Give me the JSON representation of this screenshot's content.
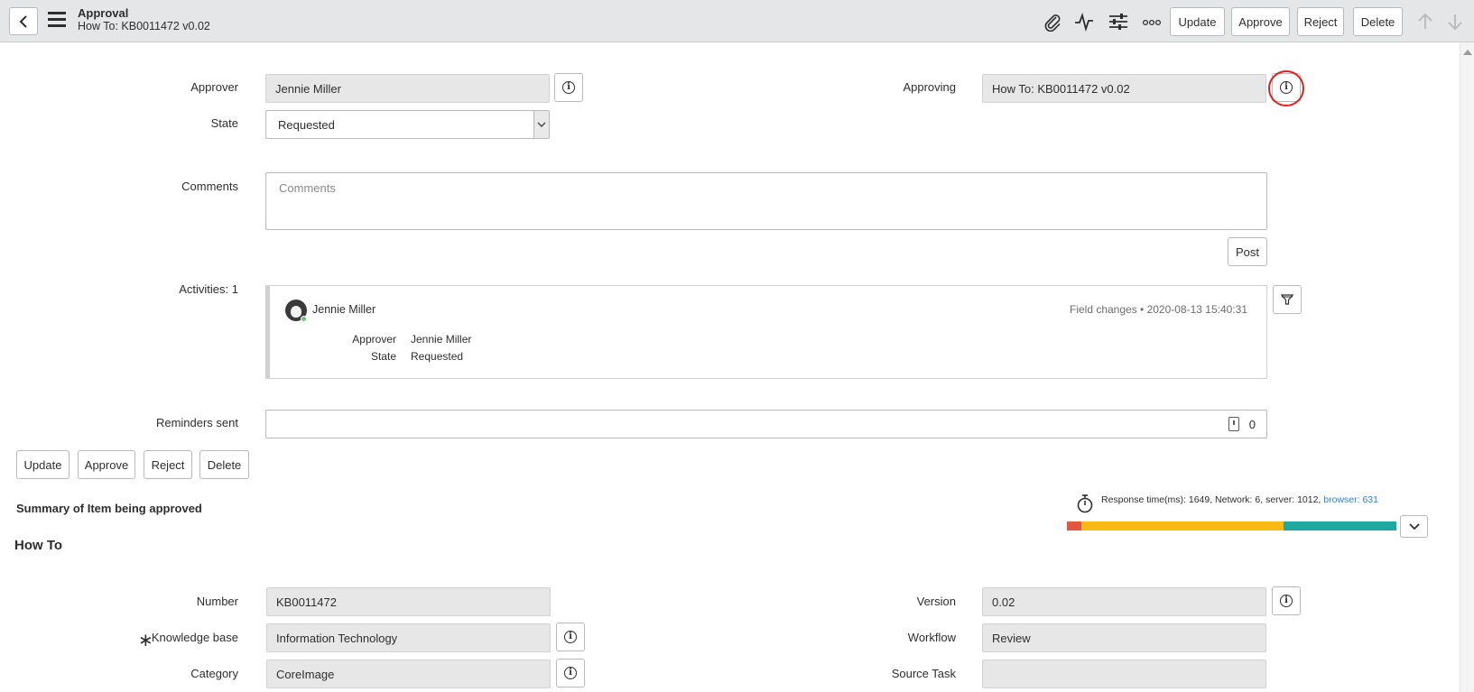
{
  "header": {
    "title": "Approval",
    "subtitle": "How To: KB0011472 v0.02",
    "buttons": {
      "update": "Update",
      "approve": "Approve",
      "reject": "Reject",
      "delete": "Delete"
    }
  },
  "form": {
    "approver": {
      "label": "Approver",
      "value": "Jennie Miller"
    },
    "state": {
      "label": "State",
      "value": "Requested"
    },
    "approving": {
      "label": "Approving",
      "value": "How To: KB0011472 v0.02"
    },
    "comments": {
      "label": "Comments",
      "placeholder": "Comments"
    },
    "post_button": "Post",
    "activities": {
      "label": "Activities: 1",
      "entry": {
        "user": "Jennie Miller",
        "meta": "Field changes  •  2020-08-13 15:40:31",
        "changes": [
          {
            "field": "Approver",
            "value": "Jennie Miller"
          },
          {
            "field": "State",
            "value": "Requested"
          }
        ]
      }
    },
    "reminders": {
      "label": "Reminders sent",
      "value": "0"
    },
    "buttons": {
      "update": "Update",
      "approve": "Approve",
      "reject": "Reject",
      "delete": "Delete"
    }
  },
  "summary": {
    "subtitle": "Summary of Item being approved",
    "heading": "How To",
    "fields": {
      "number": {
        "label": "Number",
        "value": "KB0011472"
      },
      "knowledge_base": {
        "label": "Knowledge base",
        "value": "Information Technology"
      },
      "category": {
        "label": "Category",
        "value": "CoreImage"
      },
      "version": {
        "label": "Version",
        "value": "0.02"
      },
      "workflow": {
        "label": "Workflow",
        "value": "Review"
      },
      "source_task": {
        "label": "Source Task",
        "value": ""
      }
    }
  },
  "response_time": {
    "text": "Response time(ms): 1649, Network: 6, server: 1012, ",
    "browser_link": "browser: 631",
    "segments": [
      {
        "name": "network",
        "ms": 6,
        "color": "#e2573f"
      },
      {
        "name": "server",
        "ms": 1012,
        "color": "#fbba13"
      },
      {
        "name": "browser",
        "ms": 631,
        "color": "#1ea8a0"
      }
    ]
  }
}
